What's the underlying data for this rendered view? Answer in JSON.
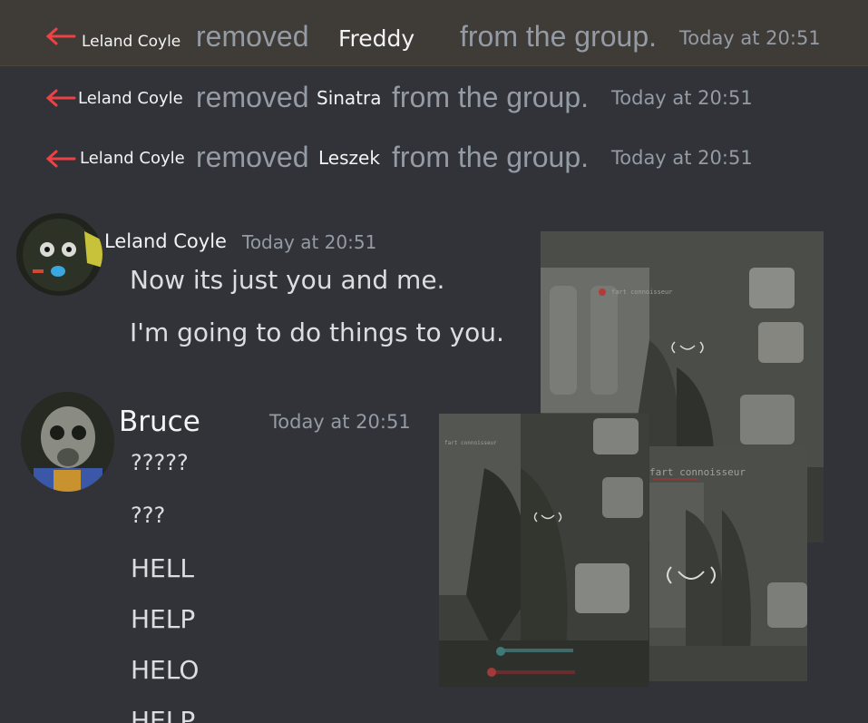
{
  "system_messages": [
    {
      "actor": "Leland Coyle",
      "verb": "removed",
      "target": "Freddy",
      "rest": "from the group.",
      "time": "Today at 20:51"
    },
    {
      "actor": "Leland Coyle",
      "verb": "removed",
      "target": "Sinatra",
      "rest": "from the group.",
      "time": "Today at 20:51"
    },
    {
      "actor": "Leland Coyle",
      "verb": "removed",
      "target": "Leszek",
      "rest": "from the group.",
      "time": "Today at 20:51"
    }
  ],
  "messages": [
    {
      "author": "Leland Coyle",
      "time": "Today at 20:51",
      "lines": [
        "Now its just you and me.",
        "I'm going to do things to you."
      ]
    },
    {
      "author": "Bruce",
      "time": "Today at 20:51",
      "lines": [
        "?????",
        "???",
        "HELL",
        "HELP",
        "HELO",
        "HELP"
      ]
    }
  ],
  "screenshots": {
    "caption": "fart connoisseur"
  },
  "colors": {
    "background": "#313338",
    "highlight": "#3f3b36",
    "arrow": "#ed4245",
    "muted": "#949ba4",
    "name": "#f2f3f5"
  },
  "icons": {
    "arrow": "left-arrow-icon",
    "ping": "signal-icon"
  }
}
